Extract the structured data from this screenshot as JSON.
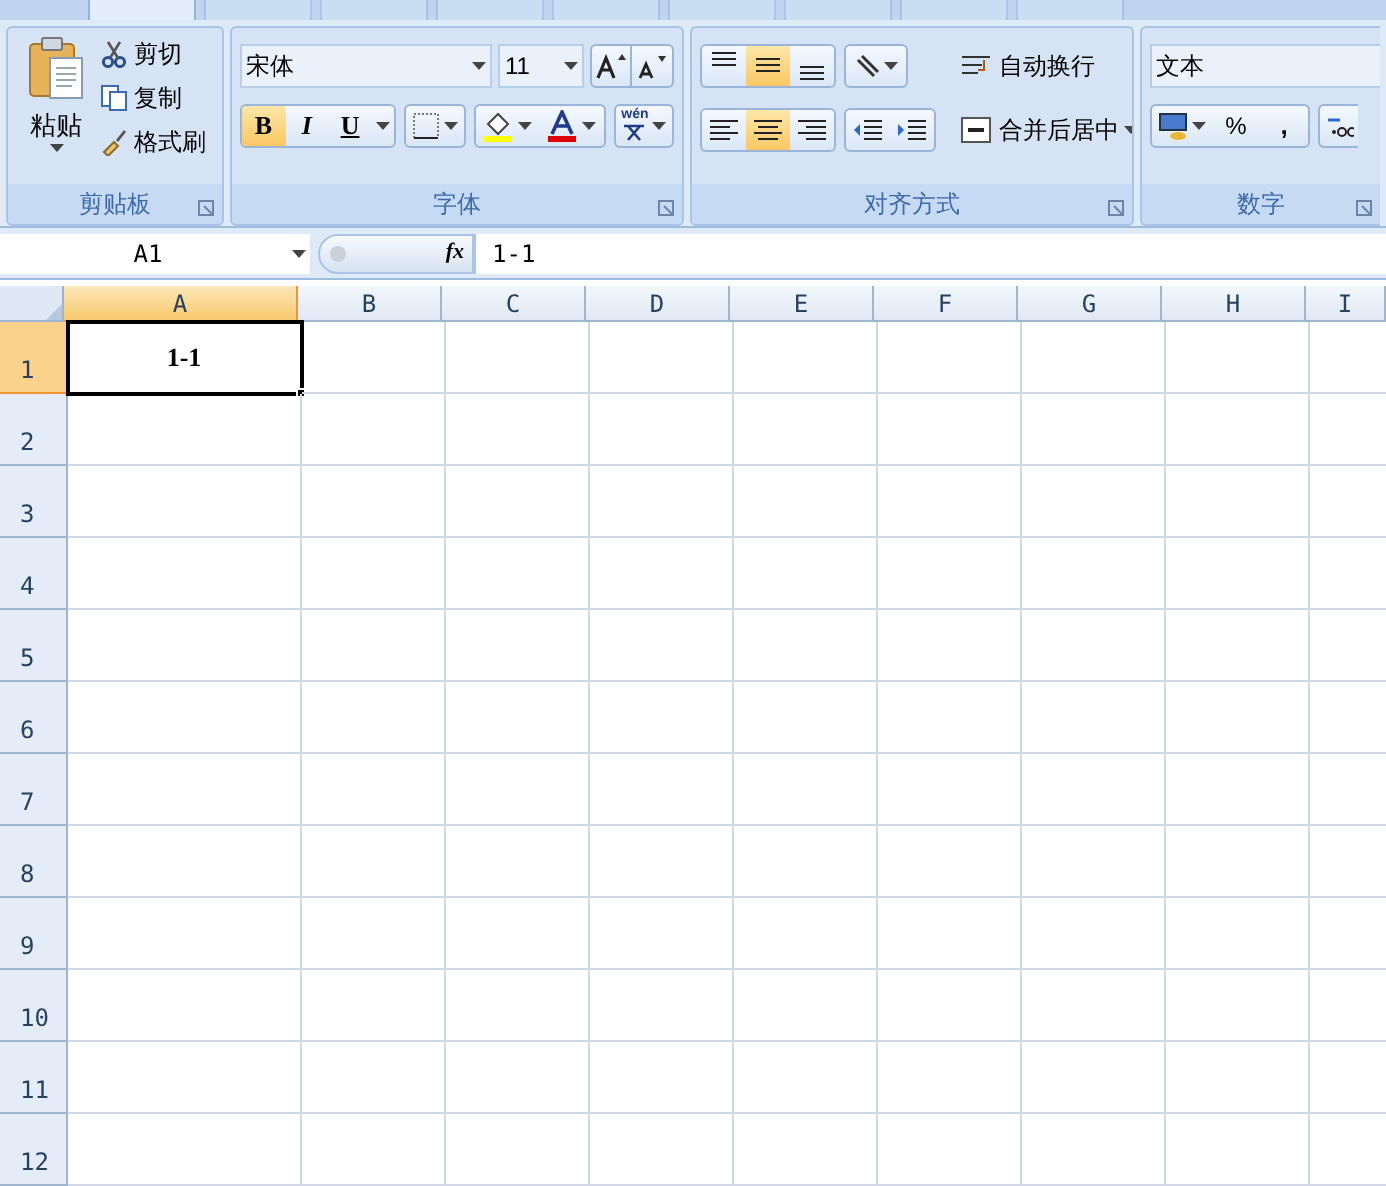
{
  "ribbon_tabs": [
    {
      "selected": true
    },
    {
      "selected": false
    },
    {
      "selected": false
    },
    {
      "selected": false
    },
    {
      "selected": false
    },
    {
      "selected": false
    },
    {
      "selected": false
    },
    {
      "selected": false
    },
    {
      "selected": false
    }
  ],
  "clipboard": {
    "paste": "粘贴",
    "cut": "剪切",
    "copy": "复制",
    "format_painter": "格式刷",
    "label": "剪贴板"
  },
  "font": {
    "name": "宋体",
    "size": "11",
    "bold": {
      "label": "B",
      "on": true
    },
    "italic": {
      "label": "I",
      "on": false
    },
    "underline": {
      "label": "U",
      "on": false
    },
    "phonetic": "wén",
    "label": "字体"
  },
  "alignment": {
    "vertical": [
      {
        "selected": false
      },
      {
        "selected": true
      },
      {
        "selected": false
      }
    ],
    "horizontal": [
      {
        "selected": false
      },
      {
        "selected": true
      },
      {
        "selected": false
      }
    ],
    "wrap_text": "自动换行",
    "merge_center": "合并后居中",
    "label": "对齐方式"
  },
  "number": {
    "format": "文本",
    "percent": "%",
    "comma": ",",
    "label": "数字"
  },
  "formula_bar": {
    "name_box": "A1",
    "fx": "fx",
    "value": "1-1"
  },
  "sheet": {
    "columns": [
      {
        "label": "A",
        "selected": true
      },
      {
        "label": "B",
        "selected": false
      },
      {
        "label": "C",
        "selected": false
      },
      {
        "label": "D",
        "selected": false
      },
      {
        "label": "E",
        "selected": false
      },
      {
        "label": "F",
        "selected": false
      },
      {
        "label": "G",
        "selected": false
      },
      {
        "label": "H",
        "selected": false
      },
      {
        "label": "I",
        "selected": false
      }
    ],
    "rows": [
      {
        "label": "1",
        "selected": true,
        "cells": [
          "1-1"
        ]
      },
      {
        "label": "2",
        "selected": false,
        "cells": []
      },
      {
        "label": "3",
        "selected": false,
        "cells": []
      },
      {
        "label": "4",
        "selected": false,
        "cells": []
      },
      {
        "label": "5",
        "selected": false,
        "cells": []
      },
      {
        "label": "6",
        "selected": false,
        "cells": []
      },
      {
        "label": "7",
        "selected": false,
        "cells": []
      },
      {
        "label": "8",
        "selected": false,
        "cells": []
      },
      {
        "label": "9",
        "selected": false,
        "cells": []
      },
      {
        "label": "10",
        "selected": false,
        "cells": []
      },
      {
        "label": "11",
        "selected": false,
        "cells": []
      },
      {
        "label": "12",
        "selected": false,
        "cells": []
      }
    ]
  }
}
